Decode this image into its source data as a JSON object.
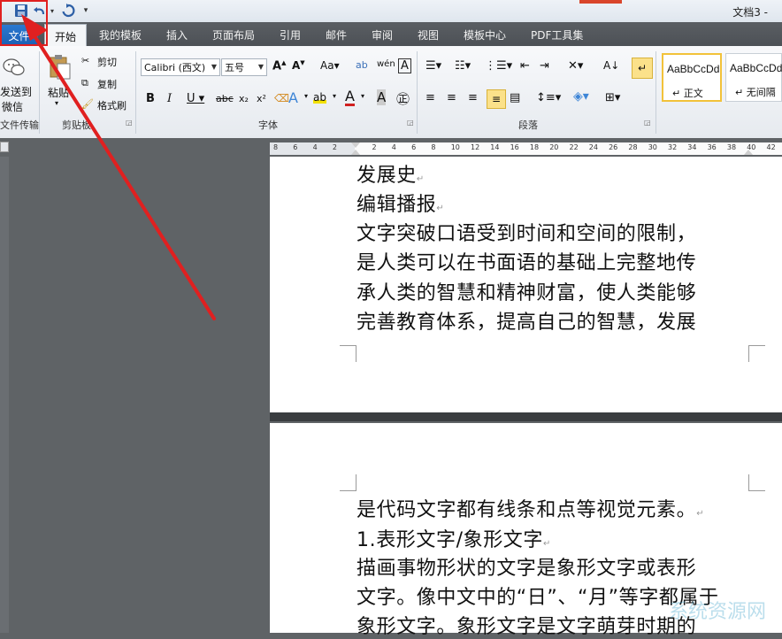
{
  "window": {
    "doc_title": "文档3 -"
  },
  "tabs": {
    "file": "文件",
    "home": "开始",
    "others": [
      "我的模板",
      "插入",
      "页面布局",
      "引用",
      "邮件",
      "审阅",
      "视图",
      "模板中心",
      "PDF工具集"
    ]
  },
  "ribbon": {
    "wechat": {
      "label1": "发送到",
      "label2": "微信",
      "group": "文件传输"
    },
    "clipboard": {
      "paste": "粘贴",
      "cut": "剪切",
      "copy": "复制",
      "format_painter": "格式刷",
      "group": "剪贴板"
    },
    "font": {
      "font_name": "Calibri (西文)",
      "font_size": "五号",
      "group": "字体"
    },
    "paragraph": {
      "group": "段落"
    },
    "styles": {
      "normal_sample": "AaBbCcDd",
      "normal_name": "正文",
      "nospace_sample": "AaBbCcDd",
      "nospace_name": "无间隔"
    }
  },
  "ruler": {
    "ticks": [
      "8",
      "6",
      "4",
      "2",
      "",
      "2",
      "4",
      "6",
      "8",
      "10",
      "12",
      "14",
      "16",
      "18",
      "20",
      "22",
      "24",
      "26",
      "28",
      "30",
      "32",
      "34",
      "36",
      "38",
      "40",
      "42"
    ]
  },
  "page1": {
    "lines": [
      "发展史",
      "编辑播报",
      "文字突破口语受到时间和空间的限制，",
      "是人类可以在书面语的基础上完整地传",
      "承人类的智慧和精神财富，使人类能够",
      "完善教育体系，提高自己的智慧，发展"
    ]
  },
  "page2": {
    "lines": [
      "是代码文字都有线条和点等视觉元素。",
      "1.表形文字/象形文字",
      "描画事物形状的文字是象形文字或表形",
      "文字。像中文中的“日”、“月”等字都属于",
      "象形文字。象形文字是文字萌芽时期的"
    ]
  },
  "colors": {
    "accent_file_tab": "#1d5fb3",
    "annotation_red": "#e02020"
  },
  "watermark": "系统资源网"
}
